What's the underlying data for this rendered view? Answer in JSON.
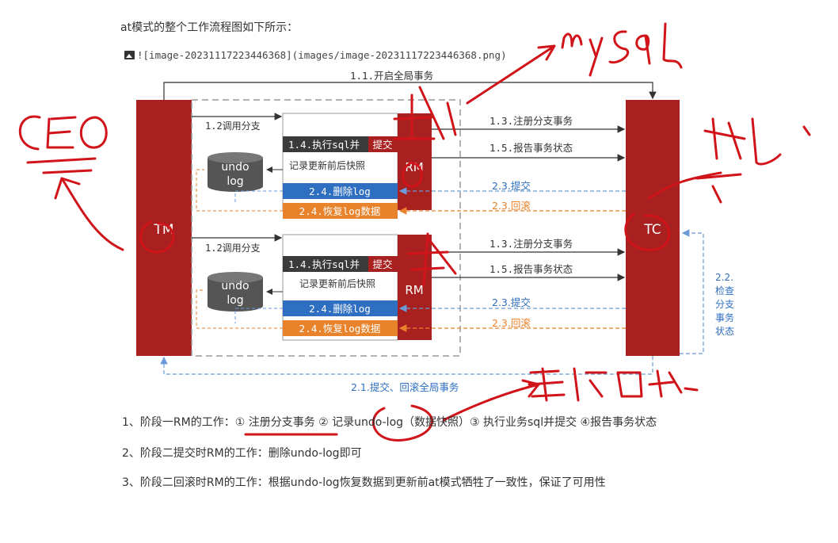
{
  "intro_text": "at模式的整个工作流程图如下所示：",
  "image_markdown": "![image-20231117223446368](images/image-20231117223446368.png)",
  "diagram": {
    "tm_label": "TM",
    "tc_label": "TC",
    "rm_label": "RM",
    "top_label": "1.1.开启全局事务",
    "bottom_label": "2.1.提交、回滚全局事务",
    "check_label": [
      "2.2.",
      "检查",
      "分支",
      "事务",
      "状态"
    ],
    "call_branch": "1.2调用分支",
    "exec_sql": "1.4.执行sql并",
    "exec_commit": "提交",
    "snapshot": "记录更新前后快照",
    "delete_log": "2.4.删除log",
    "restore_log": "2.4.恢复log数据",
    "register": "1.3.注册分支事务",
    "report": "1.5.报告事务状态",
    "commit": "2.3.提交",
    "rollback": "2.3.回滚",
    "undo_line1": "undo",
    "undo_line2": "log"
  },
  "list_items": [
    "1、阶段一RM的工作：① 注册分支事务 ② 记录undo-log（数据快照）③ 执行业务sql并提交 ④报告事务状态",
    "2、阶段二提交时RM的工作：删除undo-log即可",
    "3、阶段二回滚时RM的工作：根据undo-log恢复数据到更新前at模式牺牲了一致性，保证了可用性"
  ],
  "colors": {
    "dark_red": "#a8201f",
    "blue": "#2f6fc1",
    "orange": "#e8822b",
    "dashed_blue": "#6b9bd8",
    "ink": "#d0141a"
  }
}
